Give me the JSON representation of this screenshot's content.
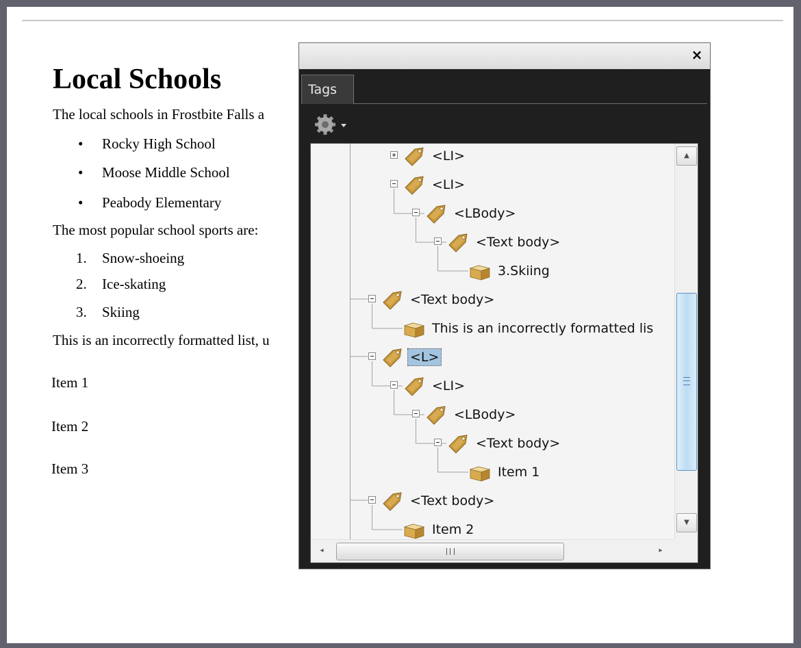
{
  "document": {
    "title": "Local Schools",
    "intro": "The local schools in Frostbite Falls a",
    "bullet_items": [
      "Rocky High School",
      "Moose Middle School",
      "Peabody Elementary"
    ],
    "bullet_marker": "•",
    "sports_intro": "The most popular school sports are:",
    "numbered_markers": [
      "1.",
      "2.",
      "3."
    ],
    "numbered_items": [
      "Snow-shoeing",
      "Ice-skating",
      "Skiing"
    ],
    "incorrect_note": "This is an incorrectly formatted list, u",
    "plain_items": [
      "Item 1",
      "Item 2",
      "Item 3"
    ]
  },
  "tags_panel": {
    "close_glyph": "×",
    "tab_label": "Tags",
    "options_icon": "gear-icon",
    "tree": [
      {
        "label": "<LI>",
        "icon": "tag-icon",
        "expander": "plus"
      },
      {
        "label": "<LI>",
        "icon": "tag-icon",
        "expander": "minus"
      },
      {
        "label": "<LBody>",
        "icon": "tag-icon",
        "expander": "minus"
      },
      {
        "label": "<Text body>",
        "icon": "tag-icon",
        "expander": "minus"
      },
      {
        "label": "3.Skiing",
        "icon": "content-box-icon",
        "expander": "none"
      },
      {
        "label": "<Text body>",
        "icon": "tag-icon",
        "expander": "minus"
      },
      {
        "label": "This is an incorrectly formatted lis",
        "icon": "content-box-icon",
        "expander": "none"
      },
      {
        "label": "<L>",
        "icon": "tag-icon",
        "expander": "minus",
        "selected": true
      },
      {
        "label": "<LI>",
        "icon": "tag-icon",
        "expander": "minus"
      },
      {
        "label": "<LBody>",
        "icon": "tag-icon",
        "expander": "minus"
      },
      {
        "label": "<Text body>",
        "icon": "tag-icon",
        "expander": "minus"
      },
      {
        "label": "Item 1",
        "icon": "content-box-icon",
        "expander": "none"
      },
      {
        "label": "<Text body>",
        "icon": "tag-icon",
        "expander": "minus"
      },
      {
        "label": "Item 2",
        "icon": "content-box-icon",
        "expander": "none"
      }
    ],
    "hscroll_left_glyph": "◂",
    "hscroll_right_glyph": "▸",
    "vscroll_up_glyph": "▲",
    "vscroll_down_glyph": "▼",
    "colors": {
      "panel_bg": "#1f1f1f",
      "tree_bg": "#f4f4f4",
      "selection": "#a3c4e0",
      "tag_gold": "#c79a3a"
    }
  }
}
